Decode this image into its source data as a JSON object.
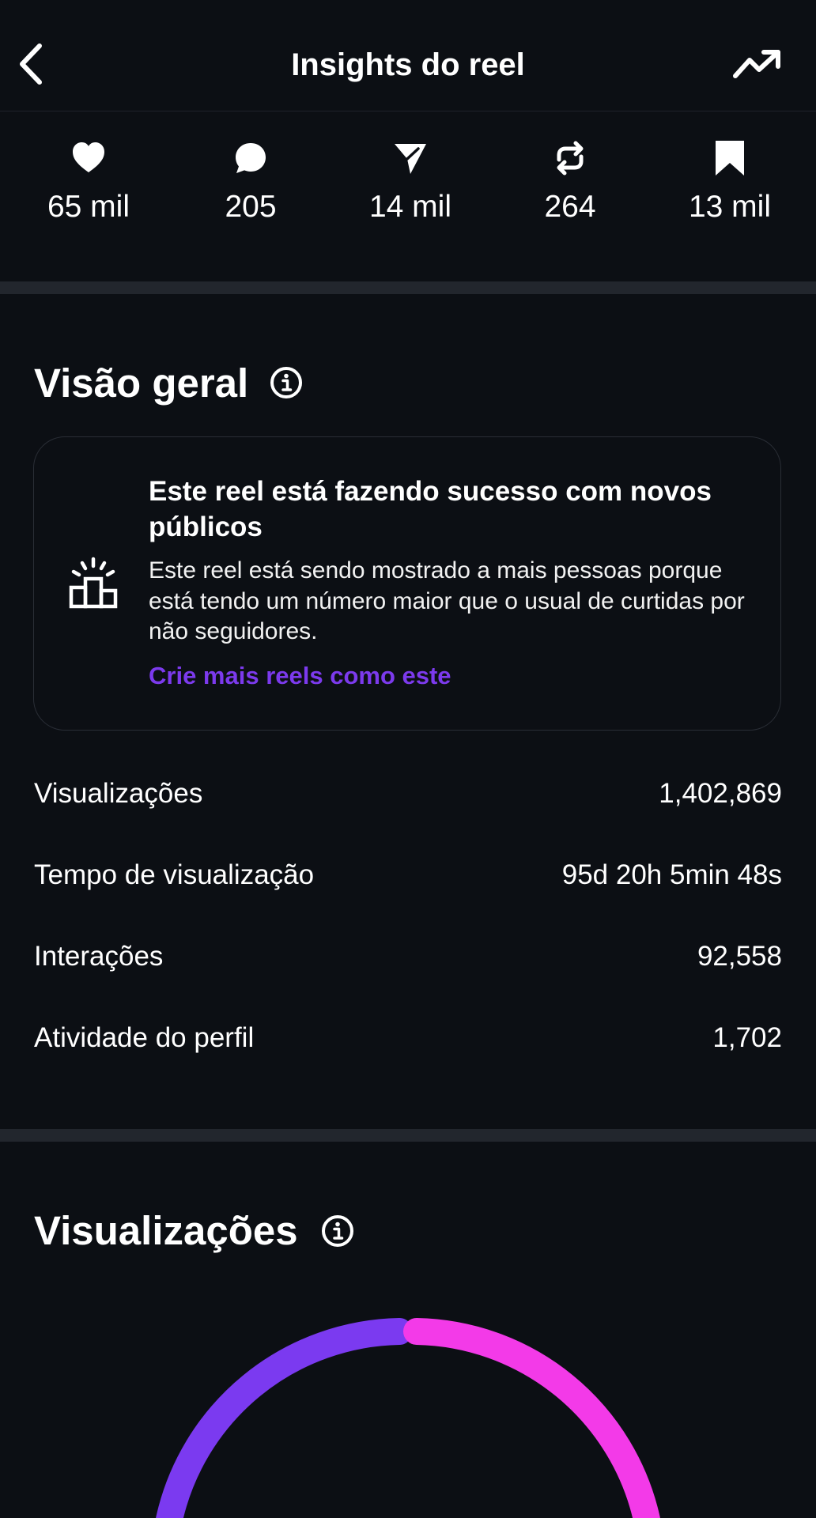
{
  "header": {
    "title": "Insights do reel",
    "back_icon": "chevron-left-icon",
    "trend_icon": "trending-up-icon"
  },
  "stats": [
    {
      "icon": "heart-icon",
      "value": "65 mil"
    },
    {
      "icon": "comment-icon",
      "value": "205"
    },
    {
      "icon": "share-icon",
      "value": "14 mil"
    },
    {
      "icon": "repost-icon",
      "value": "264"
    },
    {
      "icon": "bookmark-icon",
      "value": "13 mil"
    }
  ],
  "overview": {
    "title": "Visão geral",
    "card": {
      "icon": "podium-spotlight-icon",
      "title": "Este reel está fazendo sucesso com novos públicos",
      "body": "Este reel está sendo mostrado a mais pessoas porque está tendo um número maior que o usual de curtidas por não seguidores.",
      "link": "Crie mais reels como este"
    },
    "metrics": [
      {
        "label": "Visualizações",
        "value": "1,402,869"
      },
      {
        "label": "Tempo de visualização",
        "value": "95d 20h 5min 48s"
      },
      {
        "label": "Interações",
        "value": "92,558"
      },
      {
        "label": "Atividade do perfil",
        "value": "1,702"
      }
    ]
  },
  "views_section": {
    "title": "Visualizações",
    "segments": [
      {
        "color": "#7b3af0"
      },
      {
        "color": "#f33ae8"
      }
    ]
  },
  "colors": {
    "background": "#0c0f14",
    "divider": "#22262d",
    "accent_link": "#7c3aed"
  }
}
